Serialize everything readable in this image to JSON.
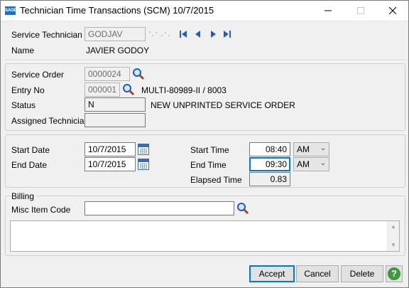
{
  "window": {
    "title": "Technician Time Transactions (SCM) 10/7/2015",
    "logo_text": "SAGE",
    "minimize_icon": "minimize-icon",
    "maximize_icon": "maximize-icon",
    "close_icon": "close-icon"
  },
  "header": {
    "technician_label": "Service Technician",
    "technician_value": "GODJAV",
    "name_label": "Name",
    "name_value": "JAVIER GODOY"
  },
  "order": {
    "service_order_label": "Service Order",
    "service_order_value": "0000024",
    "entry_no_label": "Entry No",
    "entry_no_value": "000001",
    "entry_desc": "MULTI-80989-II / 8003",
    "status_label": "Status",
    "status_value": "N",
    "status_desc": "NEW UNPRINTED SERVICE ORDER",
    "assigned_label": "Assigned Technician",
    "assigned_value": ""
  },
  "time": {
    "start_date_label": "Start Date",
    "start_date_value": "10/7/2015",
    "end_date_label": "End Date",
    "end_date_value": "10/7/2015",
    "start_time_label": "Start Time",
    "start_time_value": "08:40",
    "start_ampm": "AM",
    "end_time_label": "End Time",
    "end_time_value": "09:30",
    "end_ampm": "AM",
    "elapsed_label": "Elapsed Time",
    "elapsed_value": "0.83"
  },
  "billing": {
    "group_label": "Billing",
    "misc_item_label": "Misc Item Code",
    "misc_item_value": "",
    "comment_value": ""
  },
  "buttons": {
    "accept": "Accept",
    "cancel": "Cancel",
    "delete": "Delete",
    "help": "?"
  },
  "colors": {
    "accent": "#0078d7",
    "nav_arrow": "#1c5fbf",
    "help": "#3c9a3c"
  }
}
